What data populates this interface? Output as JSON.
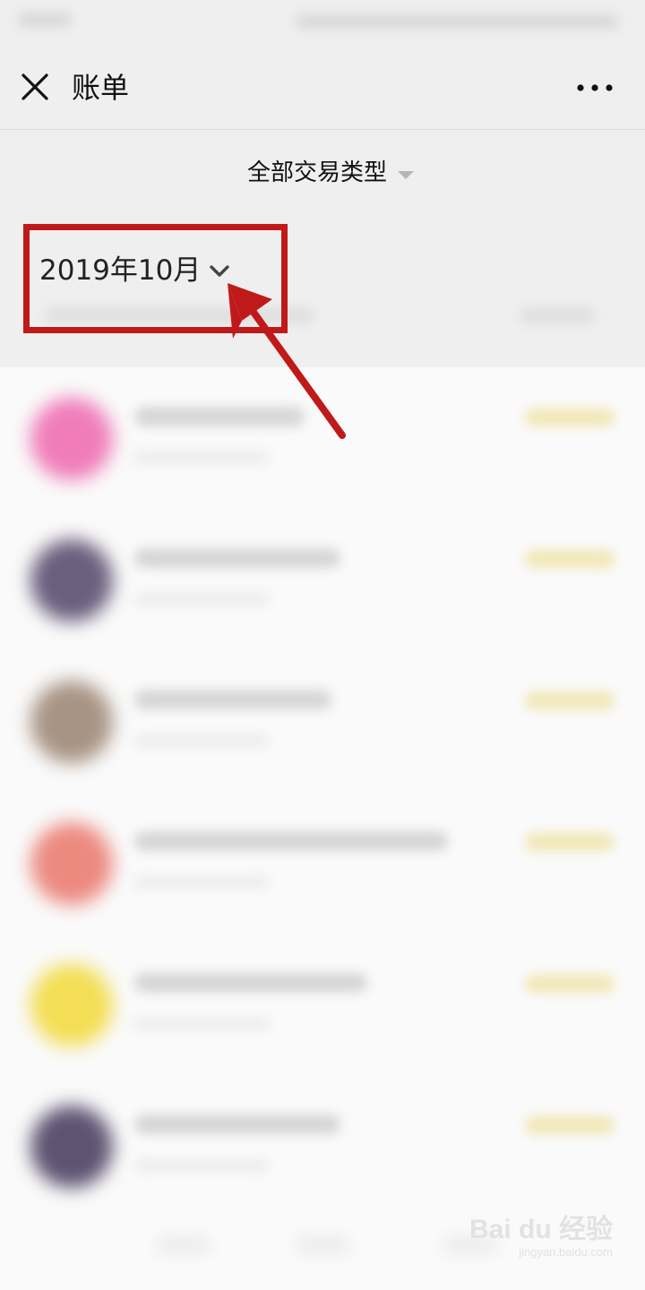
{
  "nav": {
    "title": "账单",
    "close_icon": "close-icon",
    "more_icon": "more-icon"
  },
  "filter": {
    "label": "全部交易类型",
    "caret_icon": "caret-down-icon"
  },
  "month": {
    "label": "2019年10月",
    "chevron_icon": "chevron-down-icon"
  },
  "transactions": [
    {
      "avatar_color": "#f07dba",
      "note": "blurred"
    },
    {
      "avatar_color": "#6b5f7e",
      "note": "blurred"
    },
    {
      "avatar_color": "#a89484",
      "note": "blurred"
    },
    {
      "avatar_color": "#ec8a80",
      "note": "blurred"
    },
    {
      "avatar_color": "#f3de55",
      "note": "blurred"
    },
    {
      "avatar_color": "#5e5472",
      "note": "blurred"
    }
  ],
  "annotation": {
    "color": "#c01919"
  },
  "watermark": {
    "logo": "Bai du 经验",
    "url": "jingyan.baidu.com"
  },
  "colors": {
    "header_bg": "#efefef",
    "list_bg": "#fafafa",
    "amount_tint": "#f1e7b6"
  }
}
